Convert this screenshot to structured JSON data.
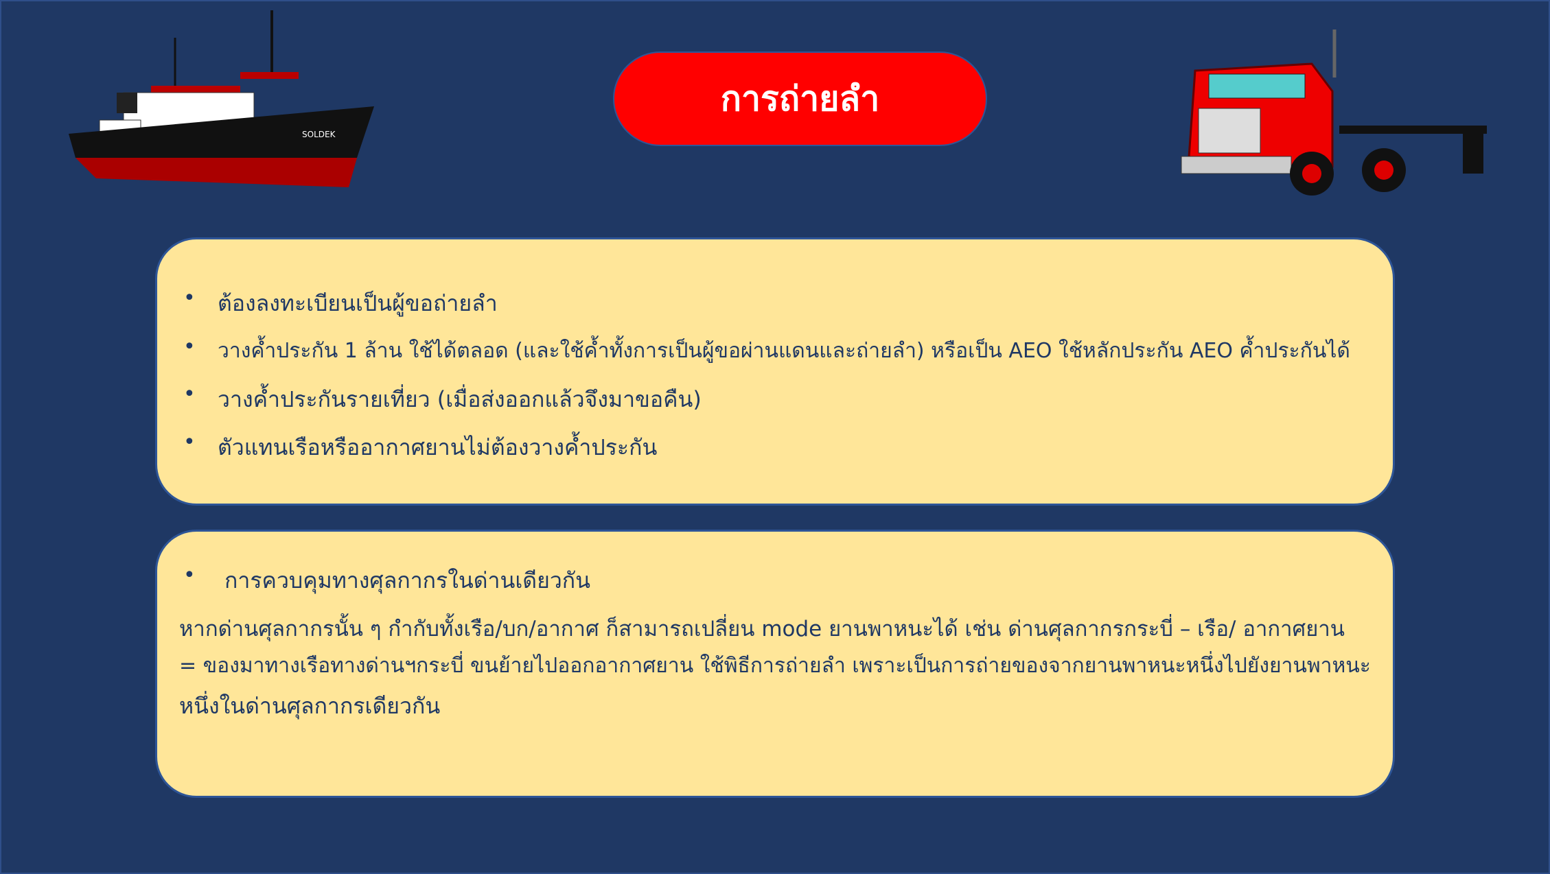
{
  "title": "การถ่ายลำ",
  "colors": {
    "background": "#1f3864",
    "title_fill": "#ff0000",
    "box_fill": "#ffe699",
    "text": "#1f3864"
  },
  "images": {
    "left": "cargo-ship",
    "right": "red-semi-truck",
    "ship_name": "SOLDEK"
  },
  "box1": {
    "bullets": [
      "ต้องลงทะเบียนเป็นผู้ขอถ่ายลำ",
      "วางค้ำประกัน 1 ล้าน ใช้ได้ตลอด (และใช้ค้ำทั้งการเป็นผู้ขอผ่านแดนและถ่ายลำ) หรือเป็น AEO ใช้หลักประกัน AEO ค้ำประกันได้",
      "วางค้ำประกันรายเที่ยว (เมื่อส่งออกแล้วจึงมาขอคืน)",
      "ตัวแทนเรือหรืออากาศยานไม่ต้องวางค้ำประกัน"
    ]
  },
  "box2": {
    "bullet": "การควบคุมทางศุลกากรในด่านเดียวกัน",
    "lines": [
      "หากด่านศุลกากรนั้น ๆ กำกับทั้งเรือ/บก/อากาศ ก็สามารถเปลี่ยน mode ยานพาหนะได้ เช่น ด่านศุลกากรกระบี่ – เรือ/ อากาศยาน",
      "= ของมาทางเรือทางด่านฯกระบี่ ขนย้ายไปออกอากาศยาน ใช้พิธีการถ่ายลำ เพราะเป็นการถ่ายของจากยานพาหนะหนึ่งไปยังยานพาหนะ",
      "หนึ่งในด่านศุลกากรเดียวกัน"
    ]
  }
}
